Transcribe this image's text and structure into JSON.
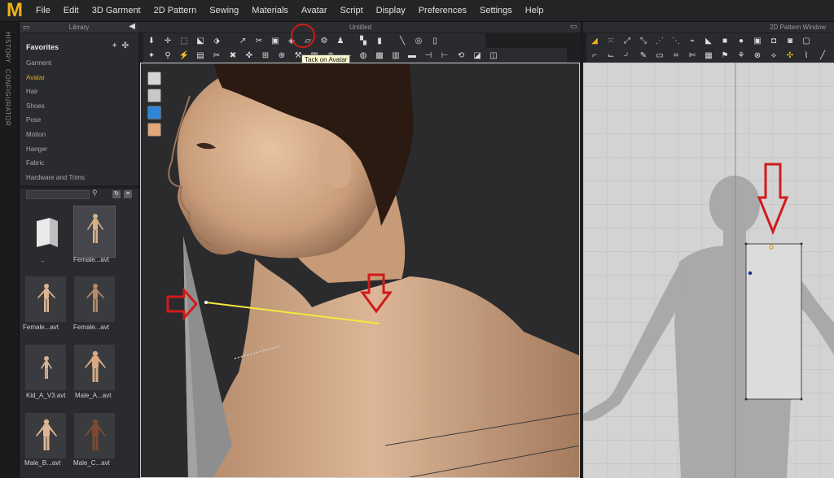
{
  "menubar": {
    "logo": "M",
    "items": [
      "File",
      "Edit",
      "3D Garment",
      "2D Pattern",
      "Sewing",
      "Materials",
      "Avatar",
      "Script",
      "Display",
      "Preferences",
      "Settings",
      "Help"
    ]
  },
  "side_tabs": [
    "HISTORY",
    "CONFIGURATOR"
  ],
  "library": {
    "title": "Library",
    "favorites": "Favorites",
    "categories": [
      "Garment",
      "Avatar",
      "Hair",
      "Shoes",
      "Pose",
      "Motion",
      "Hanger",
      "Fabric",
      "Hardware and Trims"
    ],
    "active_category": "Avatar",
    "items": [
      {
        "label": ".."
      },
      {
        "label": "Female...avt"
      },
      {
        "label": "Female...avt"
      },
      {
        "label": "Female...avt"
      },
      {
        "label": "Kid_A_V3.avt"
      },
      {
        "label": "Male_A...avt"
      },
      {
        "label": "Male_B...avt"
      },
      {
        "label": "Male_C...avt"
      }
    ]
  },
  "window3d": {
    "title": "Untitled",
    "tooltip": "Tack on Avatar"
  },
  "window2d": {
    "title": "2D Pattern Window"
  },
  "colors": {
    "accent": "#f0b21a",
    "active_category": "#e0a525",
    "annotation_red": "#d11a1a",
    "tack_line": "#f2ea3a"
  },
  "icons": {
    "toolbar3d_row1": [
      "select-icon",
      "move-icon",
      "select-mesh-icon",
      "transform-icon",
      "edit-pattern-icon",
      "arrange-icon",
      "tack-icon",
      "tack-on-avatar-icon",
      "fold-icon",
      "shirt-icon",
      "pin-icon",
      "steam-icon"
    ],
    "toolbar2d_row1": [
      "transform-icon",
      "edit-point-icon",
      "curve-icon",
      "polygon-icon",
      "rectangle-icon",
      "circle-icon",
      "pattern-icon"
    ]
  }
}
